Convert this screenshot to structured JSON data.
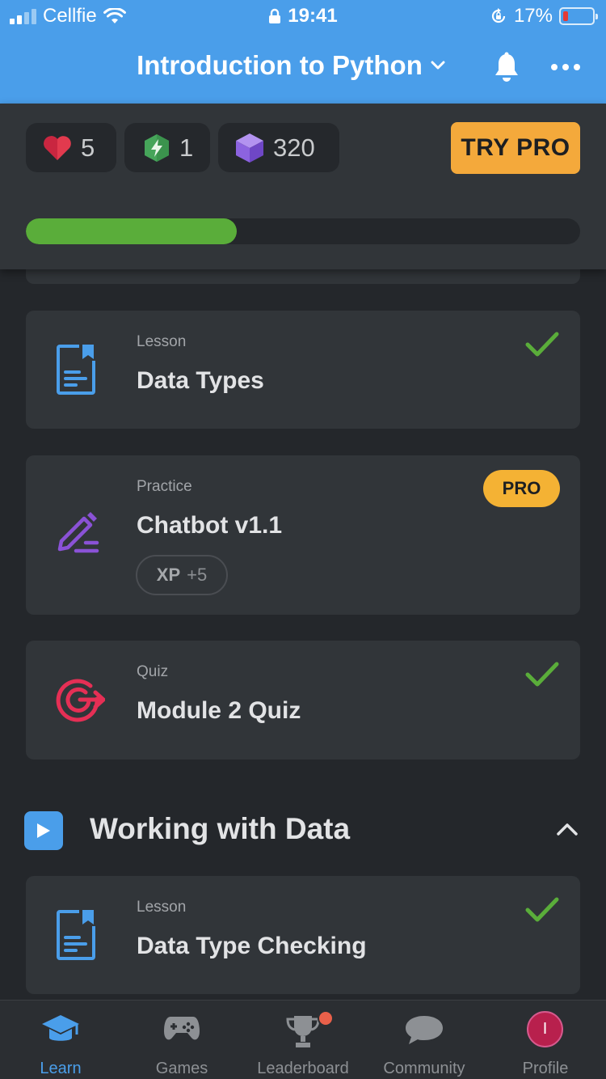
{
  "status_bar": {
    "carrier": "Cellfie",
    "time": "19:41",
    "battery_percent": "17%",
    "battery_level": 0.17,
    "battery_color": "#e53935"
  },
  "nav": {
    "title": "Introduction to Python"
  },
  "stats": {
    "hearts": "5",
    "bolts": "1",
    "gems": "320",
    "try_pro_label": "TRY PRO"
  },
  "course_progress": 0.38,
  "colors": {
    "accent": "#4a9eea",
    "progress": "#5aad3a",
    "check": "#5aad3a",
    "pro": "#f4b234"
  },
  "cards": [
    {
      "kind": "Lesson",
      "title": "Data Types",
      "completed": true,
      "icon": "lesson-icon"
    },
    {
      "kind": "Practice",
      "title": "Chatbot v1.1",
      "badge": "PRO",
      "xp_label": "XP",
      "xp_value": "+5",
      "icon": "pencil-icon"
    },
    {
      "kind": "Quiz",
      "title": "Module 2 Quiz",
      "completed": true,
      "icon": "target-icon"
    }
  ],
  "module": {
    "title": "Working with Data",
    "expanded": true,
    "cards": [
      {
        "kind": "Lesson",
        "title": "Data Type Checking",
        "completed": true,
        "icon": "lesson-icon"
      }
    ]
  },
  "tabs": [
    {
      "label": "Learn",
      "icon": "graduation-cap-icon",
      "active": true
    },
    {
      "label": "Games",
      "icon": "gamepad-icon",
      "active": false
    },
    {
      "label": "Leaderboard",
      "icon": "trophy-icon",
      "active": false,
      "has_notification": true
    },
    {
      "label": "Community",
      "icon": "chat-bubble-icon",
      "active": false
    },
    {
      "label": "Profile",
      "icon": "avatar-icon",
      "active": false
    }
  ],
  "profile_avatar_text": "I"
}
